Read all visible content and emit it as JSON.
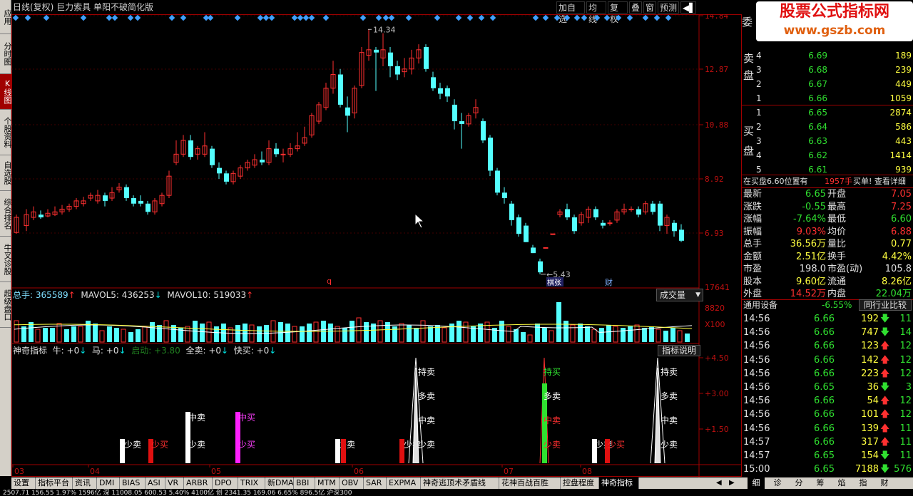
{
  "window": {
    "title": "日线(复权) 巨力索具 单阳不破简化版"
  },
  "left_tabs": [
    "应用",
    "分时图",
    "K线图",
    "个股资料",
    "自选股",
    "综合排名",
    "牛叉诊股",
    "超级盘口"
  ],
  "top_buttons": [
    "加自选",
    "均线",
    "复权",
    "叠",
    "窗",
    "预测"
  ],
  "price_axis": [
    "14.84",
    "12.87",
    "10.88",
    "8.92",
    "6.93"
  ],
  "price_annotations": {
    "high": "14.34",
    "low": "5.43",
    "marker_q": "q",
    "marker_jz": "棋张",
    "marker_cai": "财"
  },
  "volume": {
    "label": "总手: 365589",
    "ma5": "MAVOL5: 436253",
    "ma10": "MAVOL10: 519033",
    "selector": "成交量",
    "axis": [
      "17641",
      "8820",
      "X100"
    ]
  },
  "indicator": {
    "label": "神奇指标",
    "niu": "牛: +0",
    "ma": "马: +0",
    "qidong": "启动: +3.80",
    "quanmai": "全卖: +0",
    "kuaimai": "快买: +0",
    "help": "指标说明",
    "axis": [
      "+4.50",
      "+3.00",
      "+1.50"
    ],
    "signals": {
      "chi_mai": "持卖",
      "duo_mai": "多卖",
      "zhong_mai": "中卖",
      "shao_mai": "少卖",
      "chi_mai_buy": "持买",
      "duo_mai_buy": "多卖",
      "zhong_mai_buy": "中卖",
      "shao_mai_buy": "少卖",
      "zhong_mai2": "中买",
      "shao_mai2": "少买"
    }
  },
  "x_axis": [
    "03",
    "04",
    "05",
    "06",
    "07",
    "08"
  ],
  "bottom_tabs": [
    "设置",
    "指标平台",
    "资讯",
    "DMI",
    "BIAS",
    "ASI",
    "VR",
    "ARBR",
    "DPO",
    "TRIX",
    "新DMA",
    "BBI",
    "MTM",
    "OBV",
    "SAR",
    "EXPMA",
    "神奇逃顶术矛盾线",
    "花神百战百胜",
    "控盘程度",
    "神奇指标"
  ],
  "brand": {
    "text": "股票公式指标网",
    "url": "www.gszb.com"
  },
  "orderbook": {
    "sell_label": "卖盘",
    "sells": [
      {
        "n": "4",
        "p": "6.69",
        "v": "189"
      },
      {
        "n": "3",
        "p": "6.68",
        "v": "239"
      },
      {
        "n": "2",
        "p": "6.67",
        "v": "449"
      },
      {
        "n": "1",
        "p": "6.66",
        "v": "1059"
      }
    ],
    "buy_label": "买盘",
    "buys": [
      {
        "n": "1",
        "p": "6.65",
        "v": "2874"
      },
      {
        "n": "2",
        "p": "6.64",
        "v": "586"
      },
      {
        "n": "3",
        "p": "6.63",
        "v": "443"
      },
      {
        "n": "4",
        "p": "6.62",
        "v": "1414"
      },
      {
        "n": "5",
        "p": "6.61",
        "v": "939"
      }
    ],
    "notice": "在买盘6.60位置有",
    "notice_vol": "1957手",
    "notice_act": "买单! 查看详细"
  },
  "quote": [
    {
      "k1": "最新",
      "v1": "6.65",
      "k2": "开盘",
      "v2": "7.05"
    },
    {
      "k1": "涨跌",
      "v1": "-0.55",
      "k2": "最高",
      "v2": "7.25"
    },
    {
      "k1": "涨幅",
      "v1": "-7.64%",
      "k2": "最低",
      "v2": "6.60"
    },
    {
      "k1": "振幅",
      "v1": "9.03%",
      "k2": "均价",
      "v2": "6.88"
    },
    {
      "k1": "总手",
      "v1": "36.56万",
      "k2": "量比",
      "v2": "0.77"
    },
    {
      "k1": "金额",
      "v1": "2.51亿",
      "k2": "换手",
      "v2": "4.42%"
    },
    {
      "k1": "市盈",
      "v1": "198.0",
      "k2": "市盈(动)",
      "v2": "105.8"
    },
    {
      "k1": "股本",
      "v1": "9.60亿",
      "k2": "流通",
      "v2": "8.26亿"
    },
    {
      "k1": "外盘",
      "v1": "14.52万",
      "k2": "内盘",
      "v2": "22.04万"
    }
  ],
  "sector": {
    "name": "通用设备",
    "pct": "-6.55%",
    "btn": "同行业比较"
  },
  "ticks": [
    {
      "t": "14:56",
      "p": "6.66",
      "v": "192",
      "d": "down",
      "n": "11"
    },
    {
      "t": "14:56",
      "p": "6.66",
      "v": "747",
      "d": "down",
      "n": "14"
    },
    {
      "t": "14:56",
      "p": "6.66",
      "v": "123",
      "d": "up",
      "n": "12"
    },
    {
      "t": "14:56",
      "p": "6.66",
      "v": "142",
      "d": "up",
      "n": "12"
    },
    {
      "t": "14:56",
      "p": "6.66",
      "v": "223",
      "d": "up",
      "n": "12"
    },
    {
      "t": "14:56",
      "p": "6.65",
      "v": "36",
      "d": "down",
      "n": "3"
    },
    {
      "t": "14:56",
      "p": "6.66",
      "v": "54",
      "d": "up",
      "n": "12"
    },
    {
      "t": "14:56",
      "p": "6.66",
      "v": "101",
      "d": "up",
      "n": "12"
    },
    {
      "t": "14:56",
      "p": "6.66",
      "v": "139",
      "d": "up",
      "n": "11"
    },
    {
      "t": "14:57",
      "p": "6.66",
      "v": "317",
      "d": "up",
      "n": "11"
    },
    {
      "t": "14:57",
      "p": "6.65",
      "v": "154",
      "d": "down",
      "n": "11"
    },
    {
      "t": "15:00",
      "p": "6.65",
      "v": "7188",
      "d": "down",
      "n": "576"
    }
  ],
  "right_tabs": [
    "细",
    "诊",
    "分",
    "筹",
    "焰",
    "指",
    "财"
  ],
  "status_line": "2507.71  156.55  1.97%  1596亿 深  11008.05  600.53  5.40%  4100亿 创  2341.35  169.06  6.65%  896.5亿 沪深300"
}
